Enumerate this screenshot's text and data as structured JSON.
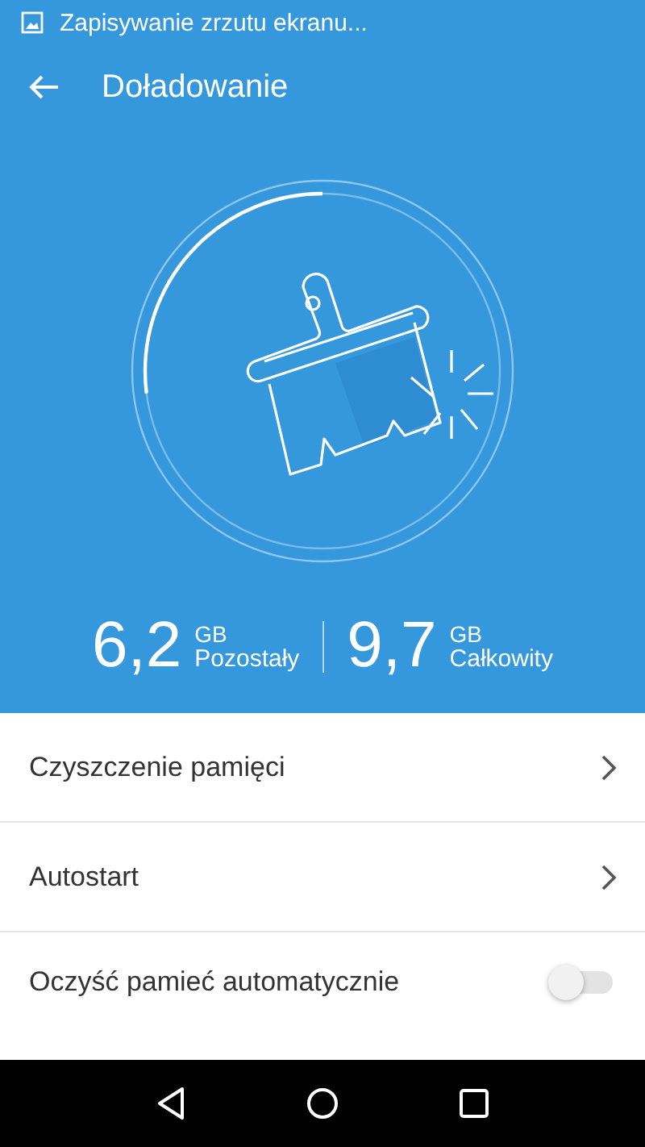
{
  "status_bar": {
    "notification": "Zapisywanie zrzutu ekranu..."
  },
  "toolbar": {
    "title": "Doładowanie"
  },
  "gauge": {
    "level": 0.27
  },
  "stats": [
    {
      "value": "6,2",
      "unit": "GB",
      "label": "Pozostały"
    },
    {
      "value": "9,7",
      "unit": "GB",
      "label": "Całkowity"
    }
  ],
  "items": [
    {
      "kind": "link",
      "label": "Czyszczenie pamięci"
    },
    {
      "kind": "link",
      "label": "Autostart"
    },
    {
      "kind": "toggle",
      "label": "Oczyść pamieć automatycznie",
      "on": false
    }
  ]
}
